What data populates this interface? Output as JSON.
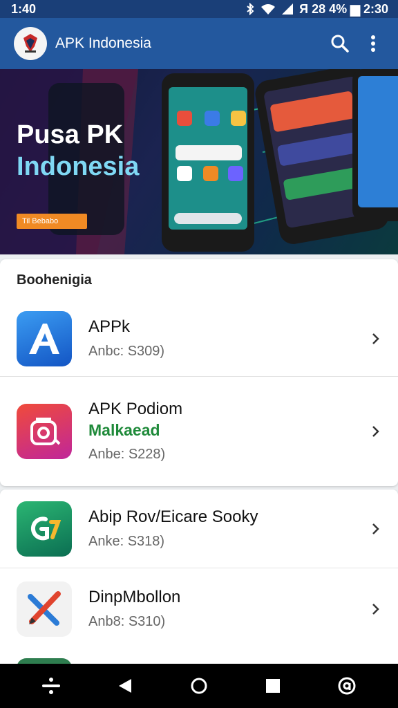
{
  "status_bar": {
    "time": "1:40",
    "right_text": "Я 28 4% ▆ 2:30"
  },
  "app_bar": {
    "title": "APK Indonesia"
  },
  "banner": {
    "line1": "Pusa PK",
    "line2": "Indonesia",
    "badge": "Til Bebabo"
  },
  "section": {
    "title": "Boohenigia"
  },
  "apps": [
    {
      "title": "APPk",
      "subtitle": "",
      "meta": "Anbc: S309)"
    },
    {
      "title": "APK Podiom",
      "subtitle": "Malkaead",
      "meta": "Anbe: S228)"
    },
    {
      "title": "Abip Rov/Eicare Sooky",
      "subtitle": "",
      "meta": "Anke: S318)"
    },
    {
      "title": "DinpMbollon",
      "subtitle": "",
      "meta": "Anb8: S310)"
    }
  ],
  "colors": {
    "status_bar": "#1a3f78",
    "app_bar": "#23589e",
    "accent_green": "#1f8a3a",
    "badge_orange": "#f08a24"
  }
}
